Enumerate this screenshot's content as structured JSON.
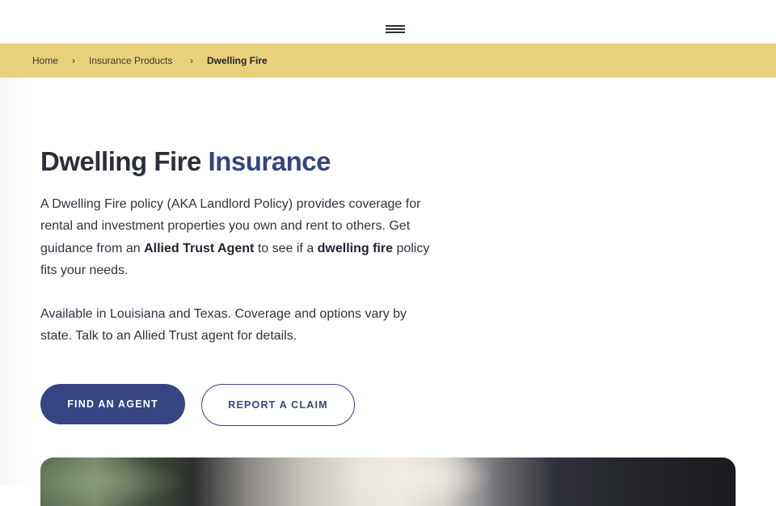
{
  "header": {
    "menu_icon": "hamburger-menu-icon"
  },
  "breadcrumb": {
    "items": [
      {
        "label": "Home"
      },
      {
        "label": "Insurance Products"
      },
      {
        "label": "Dwelling Fire"
      }
    ],
    "separator": "›"
  },
  "hero": {
    "title_main": "Dwelling Fire",
    "title_accent": "Insurance",
    "para1": {
      "part1": "A Dwelling Fire policy (AKA Landlord Policy) provides coverage for rental and investment properties you own and rent to others. Get guidance from an ",
      "bold1": "Allied Trust Agent",
      "part2": " to see if a ",
      "bold2": "dwelling fire",
      "part3": " policy fits your needs."
    },
    "para2": "Available in Louisiana and Texas. Coverage and options vary by state. Talk to an Allied Trust agent for details.",
    "primary_button": "FIND AN AGENT",
    "secondary_button": "REPORT A CLAIM"
  },
  "colors": {
    "brand_navy": "#344582",
    "breadcrumb_bg": "#ead07a",
    "text": "#2b2f3a"
  }
}
